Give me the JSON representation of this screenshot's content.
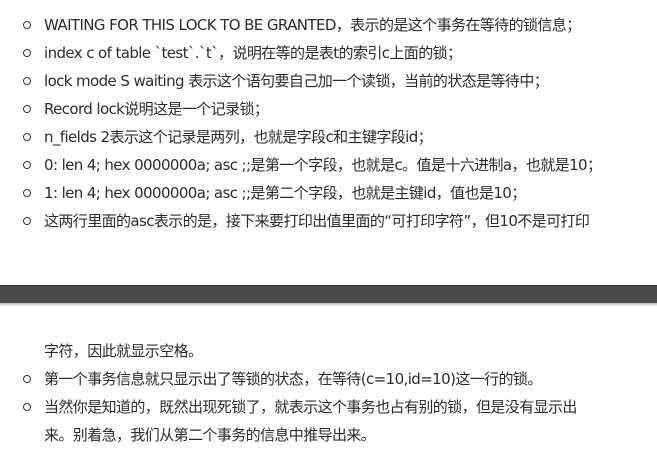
{
  "page1": {
    "items": [
      "WAITING FOR THIS LOCK TO BE GRANTED，表示的是这个事务在等待的锁信息；",
      "index c of table `test`.`t`，说明在等的是表t的索引c上面的锁；",
      "lock mode S waiting 表示这个语句要自己加一个读锁，当前的状态是等待中；",
      "Record lock说明这是一个记录锁；",
      "n_fields 2表示这个记录是两列，也就是字段c和主键字段id；",
      "0: len 4; hex 0000000a; asc ;;是第一个字段，也就是c。值是十六进制a，也就是10；",
      "1: len 4; hex 0000000a; asc ;;是第二个字段，也就是主键id，值也是10；",
      "这两行里面的asc表示的是，接下来要打印出值里面的“可打印字符”，但10不是可打印"
    ]
  },
  "page2": {
    "continuation": "字符，因此就显示空格。",
    "items": [
      "第一个事务信息就只显示出了等锁的状态，在等待(c=10,id=10)这一行的锁。",
      "当然你是知道的，既然出现死锁了，就表示这个事务也占有别的锁，但是没有显示出",
      "来。别着急，我们从第二个事务的信息中推导出来。"
    ]
  }
}
